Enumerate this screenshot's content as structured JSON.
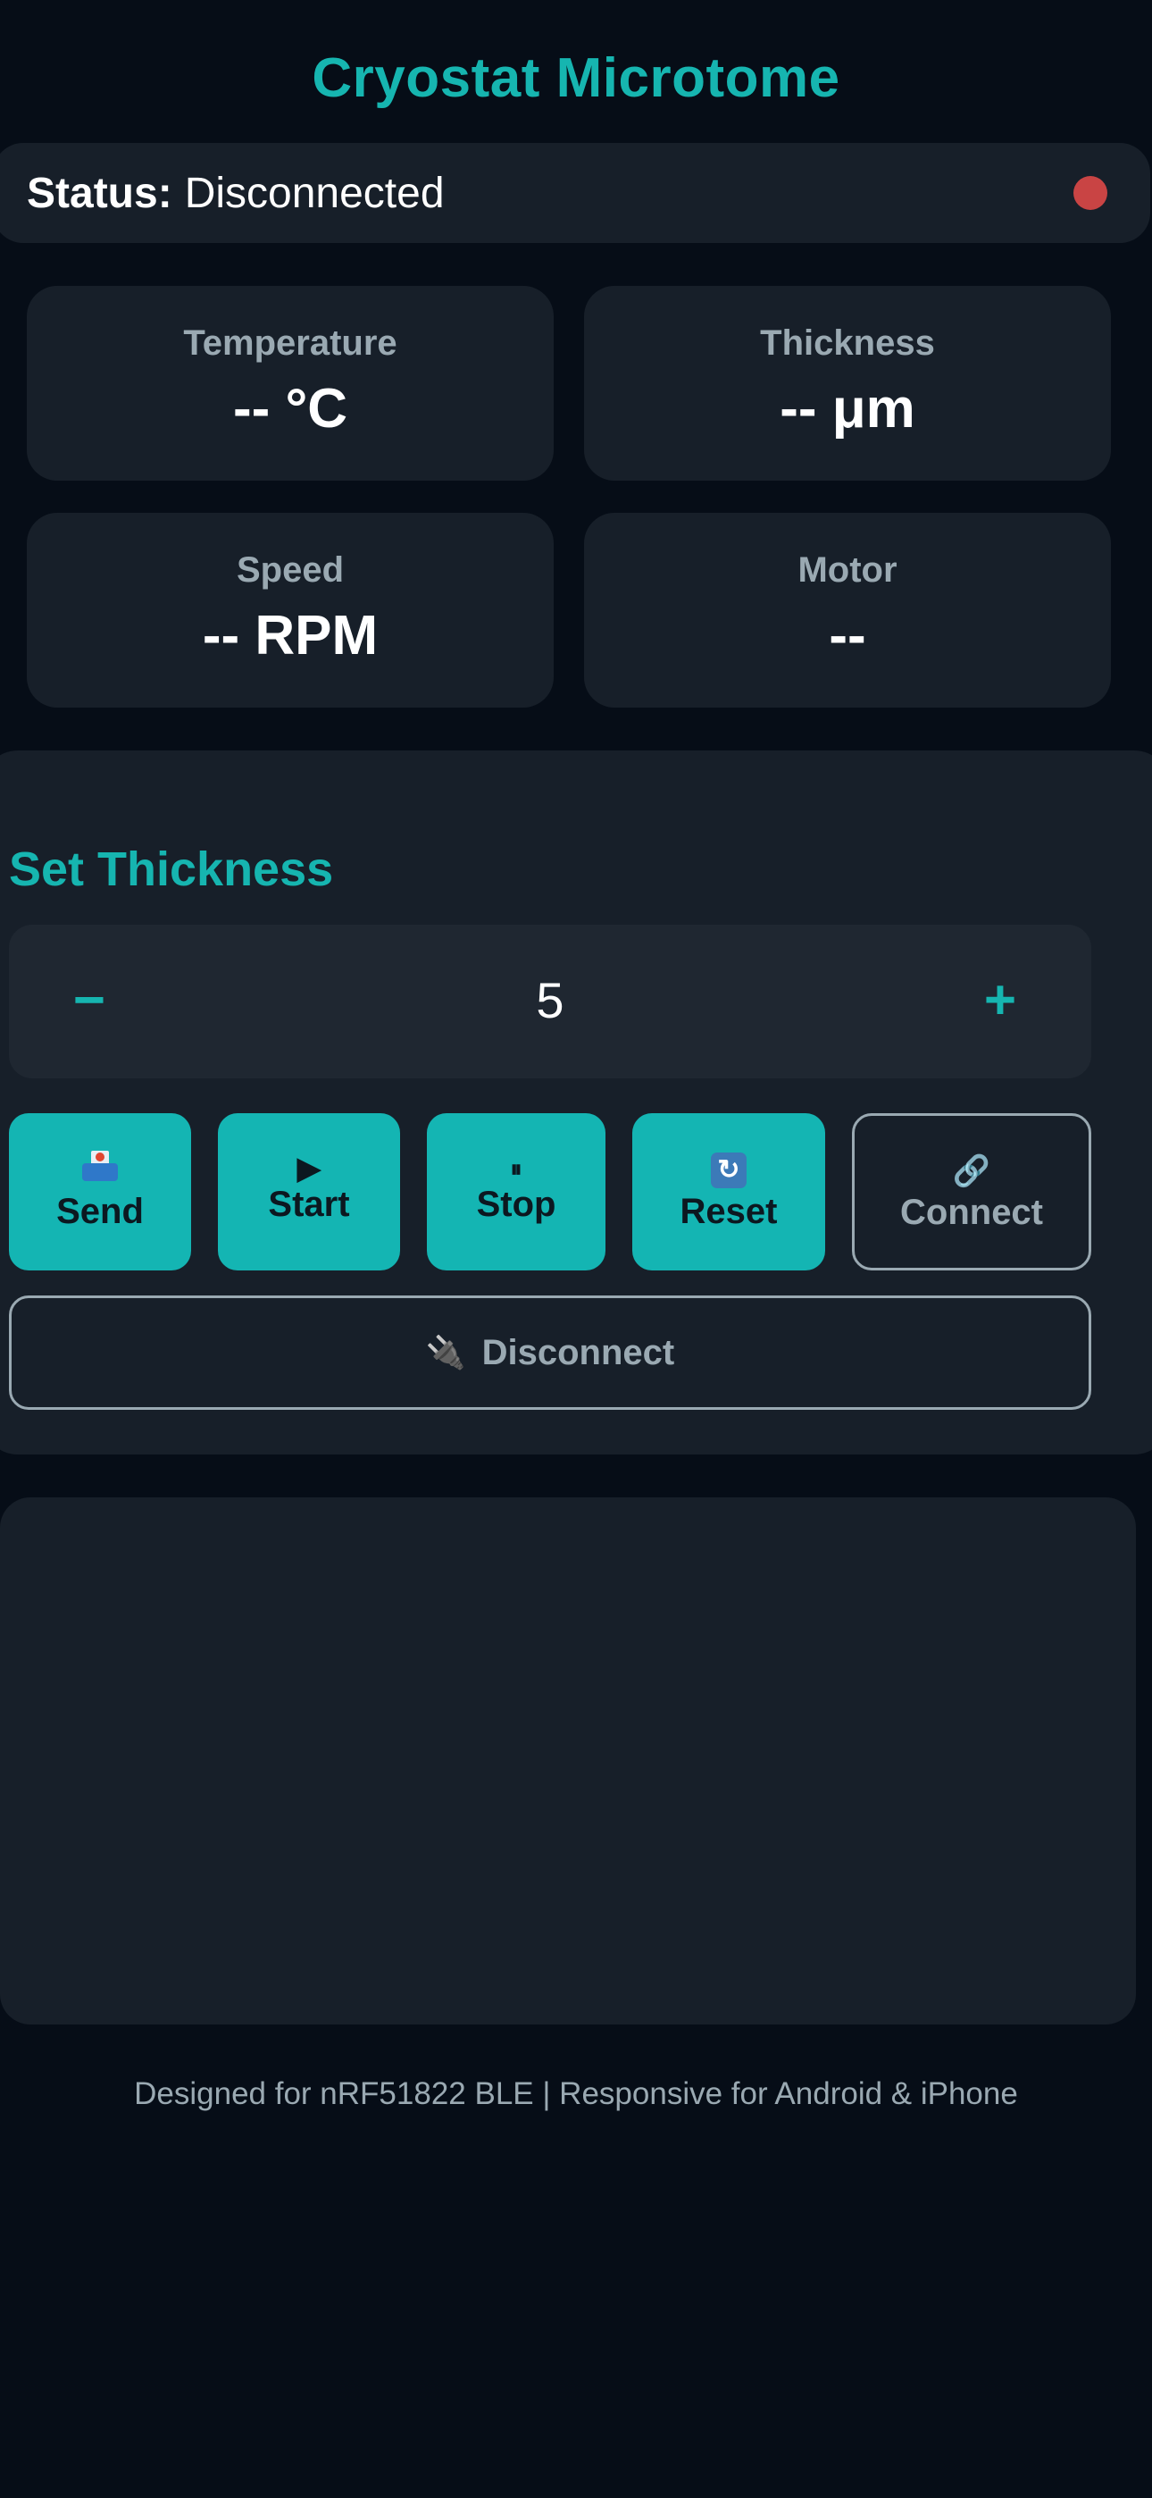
{
  "app": {
    "title": "Cryostat Microtome"
  },
  "status": {
    "label": "Status:",
    "value": "Disconnected",
    "indicator_color": "#c94444"
  },
  "stats": [
    {
      "label": "Temperature",
      "value": "-- °C"
    },
    {
      "label": "Thickness",
      "value": "-- μm"
    },
    {
      "label": "Speed",
      "value": "-- RPM"
    },
    {
      "label": "Motor",
      "value": "--"
    }
  ],
  "controls": {
    "section_title": "Set Thickness",
    "stepper": {
      "minus_label": "−",
      "value": "5",
      "plus_label": "+"
    },
    "buttons": {
      "send": {
        "icon": "inbox-tray-icon",
        "label": "Send"
      },
      "start": {
        "icon": "play-icon",
        "glyph": "▶",
        "label": "Start"
      },
      "stop": {
        "icon": "pause-icon",
        "glyph": "⏸",
        "label": "Stop"
      },
      "reset": {
        "icon": "refresh-icon",
        "glyph": "🔄",
        "label": "Reset"
      },
      "connect": {
        "icon": "link-icon",
        "glyph": "🔗",
        "label": "Connect"
      },
      "disconnect": {
        "icon": "plug-icon",
        "glyph": "🔌",
        "label": "Disconnect"
      }
    }
  },
  "footer": {
    "text": "Designed for nRF51822 BLE | Responsive for Android & iPhone"
  },
  "colors": {
    "accent": "#16b5b0",
    "background": "#060d17",
    "card": "#171f29",
    "muted_text": "#9aa9b2"
  }
}
